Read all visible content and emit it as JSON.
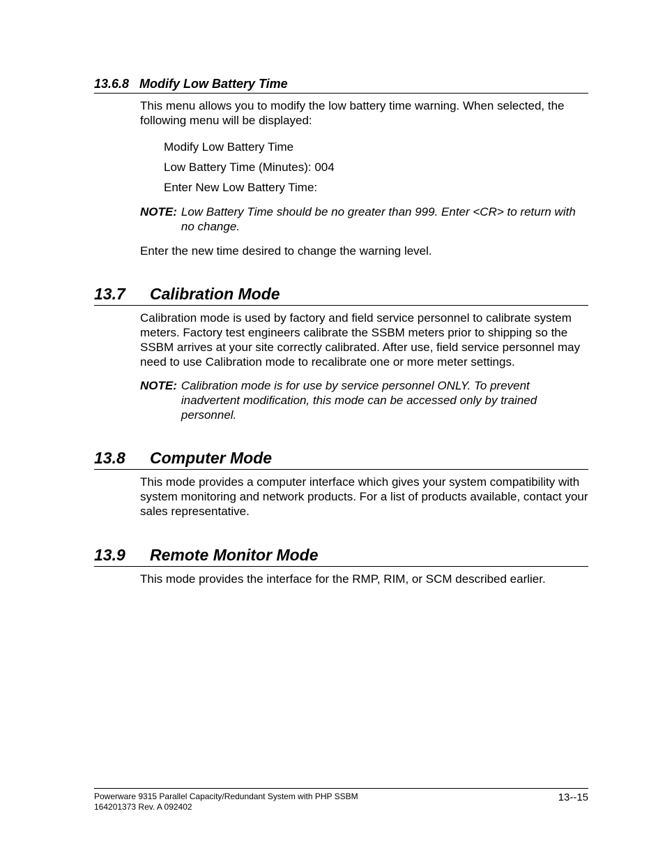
{
  "sections": {
    "s1": {
      "number": "13.6.8",
      "title": "Modify Low Battery Time",
      "intro": "This menu allows you to modify the low battery time warning. When selected, the following menu will be displayed:",
      "menu": {
        "line1": "Modify Low Battery Time",
        "line2": "Low Battery Time (Minutes):  004",
        "line3": "Enter New Low Battery Time:"
      },
      "note_label": "NOTE:",
      "note_text": "Low Battery Time should be no greater than 999.  Enter <CR> to return with no change.",
      "closing": "Enter the new time desired to change the warning level."
    },
    "s2": {
      "number": "13.7",
      "title": "Calibration Mode",
      "body": "Calibration mode is used by factory and field service personnel to calibrate system meters.  Factory test engineers calibrate the SSBM meters prior to shipping so the SSBM arrives at your site correctly calibrated.  After use, field service personnel may need to use Calibration mode to recalibrate one or more meter settings.",
      "note_label": "NOTE:",
      "note_text": "Calibration mode is for use by service personnel ONLY.  To prevent inadvertent modification, this mode can be accessed only by trained personnel."
    },
    "s3": {
      "number": "13.8",
      "title": "Computer Mode",
      "body": "This mode provides a computer interface which gives your system compatibility with system monitoring and network products. For a list of products available, contact your sales representative."
    },
    "s4": {
      "number": "13.9",
      "title": "Remote Monitor Mode",
      "body": "This mode provides the interface for the RMP, RIM, or SCM described earlier."
    }
  },
  "footer": {
    "line1": "Powerware 9315 Parallel Capacity/Redundant System with PHP SSBM",
    "line2": "164201373    Rev. A       092402",
    "page": "13--15"
  }
}
